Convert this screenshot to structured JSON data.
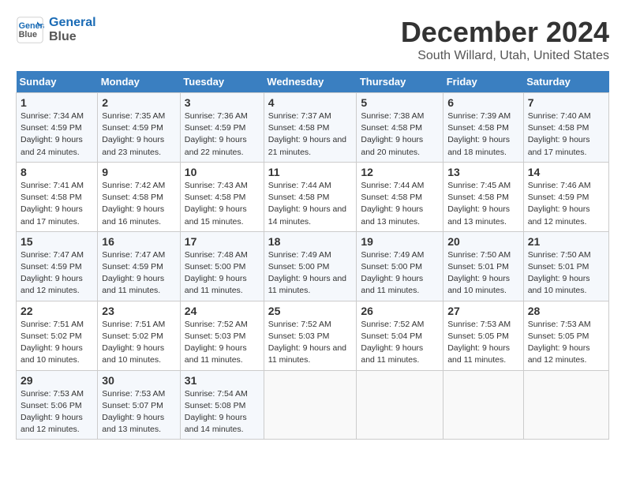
{
  "logo": {
    "line1": "General",
    "line2": "Blue"
  },
  "title": "December 2024",
  "subtitle": "South Willard, Utah, United States",
  "days_of_week": [
    "Sunday",
    "Monday",
    "Tuesday",
    "Wednesday",
    "Thursday",
    "Friday",
    "Saturday"
  ],
  "weeks": [
    [
      {
        "num": "1",
        "rise": "7:34 AM",
        "set": "4:59 PM",
        "daylight": "9 hours and 24 minutes."
      },
      {
        "num": "2",
        "rise": "7:35 AM",
        "set": "4:59 PM",
        "daylight": "9 hours and 23 minutes."
      },
      {
        "num": "3",
        "rise": "7:36 AM",
        "set": "4:59 PM",
        "daylight": "9 hours and 22 minutes."
      },
      {
        "num": "4",
        "rise": "7:37 AM",
        "set": "4:58 PM",
        "daylight": "9 hours and 21 minutes."
      },
      {
        "num": "5",
        "rise": "7:38 AM",
        "set": "4:58 PM",
        "daylight": "9 hours and 20 minutes."
      },
      {
        "num": "6",
        "rise": "7:39 AM",
        "set": "4:58 PM",
        "daylight": "9 hours and 18 minutes."
      },
      {
        "num": "7",
        "rise": "7:40 AM",
        "set": "4:58 PM",
        "daylight": "9 hours and 17 minutes."
      }
    ],
    [
      {
        "num": "8",
        "rise": "7:41 AM",
        "set": "4:58 PM",
        "daylight": "9 hours and 17 minutes."
      },
      {
        "num": "9",
        "rise": "7:42 AM",
        "set": "4:58 PM",
        "daylight": "9 hours and 16 minutes."
      },
      {
        "num": "10",
        "rise": "7:43 AM",
        "set": "4:58 PM",
        "daylight": "9 hours and 15 minutes."
      },
      {
        "num": "11",
        "rise": "7:44 AM",
        "set": "4:58 PM",
        "daylight": "9 hours and 14 minutes."
      },
      {
        "num": "12",
        "rise": "7:44 AM",
        "set": "4:58 PM",
        "daylight": "9 hours and 13 minutes."
      },
      {
        "num": "13",
        "rise": "7:45 AM",
        "set": "4:58 PM",
        "daylight": "9 hours and 13 minutes."
      },
      {
        "num": "14",
        "rise": "7:46 AM",
        "set": "4:59 PM",
        "daylight": "9 hours and 12 minutes."
      }
    ],
    [
      {
        "num": "15",
        "rise": "7:47 AM",
        "set": "4:59 PM",
        "daylight": "9 hours and 12 minutes."
      },
      {
        "num": "16",
        "rise": "7:47 AM",
        "set": "4:59 PM",
        "daylight": "9 hours and 11 minutes."
      },
      {
        "num": "17",
        "rise": "7:48 AM",
        "set": "5:00 PM",
        "daylight": "9 hours and 11 minutes."
      },
      {
        "num": "18",
        "rise": "7:49 AM",
        "set": "5:00 PM",
        "daylight": "9 hours and 11 minutes."
      },
      {
        "num": "19",
        "rise": "7:49 AM",
        "set": "5:00 PM",
        "daylight": "9 hours and 11 minutes."
      },
      {
        "num": "20",
        "rise": "7:50 AM",
        "set": "5:01 PM",
        "daylight": "9 hours and 10 minutes."
      },
      {
        "num": "21",
        "rise": "7:50 AM",
        "set": "5:01 PM",
        "daylight": "9 hours and 10 minutes."
      }
    ],
    [
      {
        "num": "22",
        "rise": "7:51 AM",
        "set": "5:02 PM",
        "daylight": "9 hours and 10 minutes."
      },
      {
        "num": "23",
        "rise": "7:51 AM",
        "set": "5:02 PM",
        "daylight": "9 hours and 10 minutes."
      },
      {
        "num": "24",
        "rise": "7:52 AM",
        "set": "5:03 PM",
        "daylight": "9 hours and 11 minutes."
      },
      {
        "num": "25",
        "rise": "7:52 AM",
        "set": "5:03 PM",
        "daylight": "9 hours and 11 minutes."
      },
      {
        "num": "26",
        "rise": "7:52 AM",
        "set": "5:04 PM",
        "daylight": "9 hours and 11 minutes."
      },
      {
        "num": "27",
        "rise": "7:53 AM",
        "set": "5:05 PM",
        "daylight": "9 hours and 11 minutes."
      },
      {
        "num": "28",
        "rise": "7:53 AM",
        "set": "5:05 PM",
        "daylight": "9 hours and 12 minutes."
      }
    ],
    [
      {
        "num": "29",
        "rise": "7:53 AM",
        "set": "5:06 PM",
        "daylight": "9 hours and 12 minutes."
      },
      {
        "num": "30",
        "rise": "7:53 AM",
        "set": "5:07 PM",
        "daylight": "9 hours and 13 minutes."
      },
      {
        "num": "31",
        "rise": "7:54 AM",
        "set": "5:08 PM",
        "daylight": "9 hours and 14 minutes."
      },
      null,
      null,
      null,
      null
    ]
  ]
}
